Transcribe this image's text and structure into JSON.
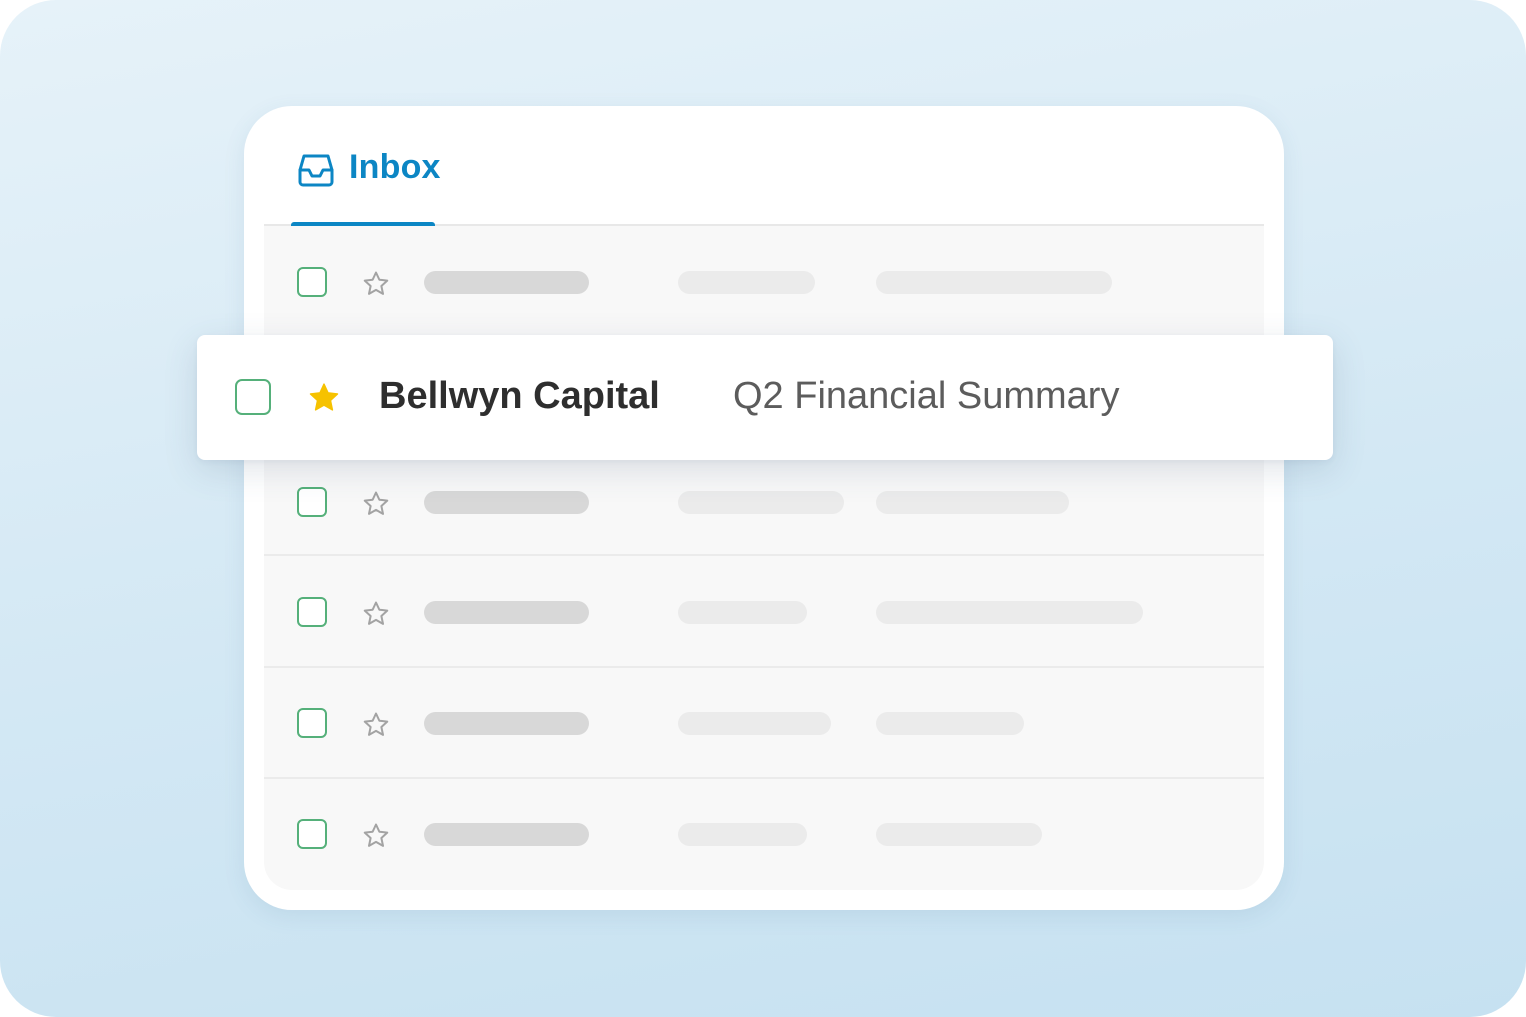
{
  "colors": {
    "accent": "#0c86c4",
    "checkbox_border": "#55b07a",
    "star_filled": "#f6c200",
    "star_outline": "#a3a3a3",
    "skeleton_dark": "#d8d8d8",
    "skeleton_light": "#ebebeb"
  },
  "tabs": [
    {
      "label": "Inbox",
      "icon": "inbox-tray-icon",
      "active": true
    }
  ],
  "featured_email": {
    "sender": "Bellwyn Capital",
    "subject": "Q2 Financial Summary",
    "starred": true,
    "checked": false
  },
  "placeholder_rows": [
    {
      "starred": false,
      "checked": false
    },
    {
      "starred": false,
      "checked": false
    },
    {
      "starred": false,
      "checked": false
    },
    {
      "starred": false,
      "checked": false
    },
    {
      "starred": false,
      "checked": false
    }
  ]
}
